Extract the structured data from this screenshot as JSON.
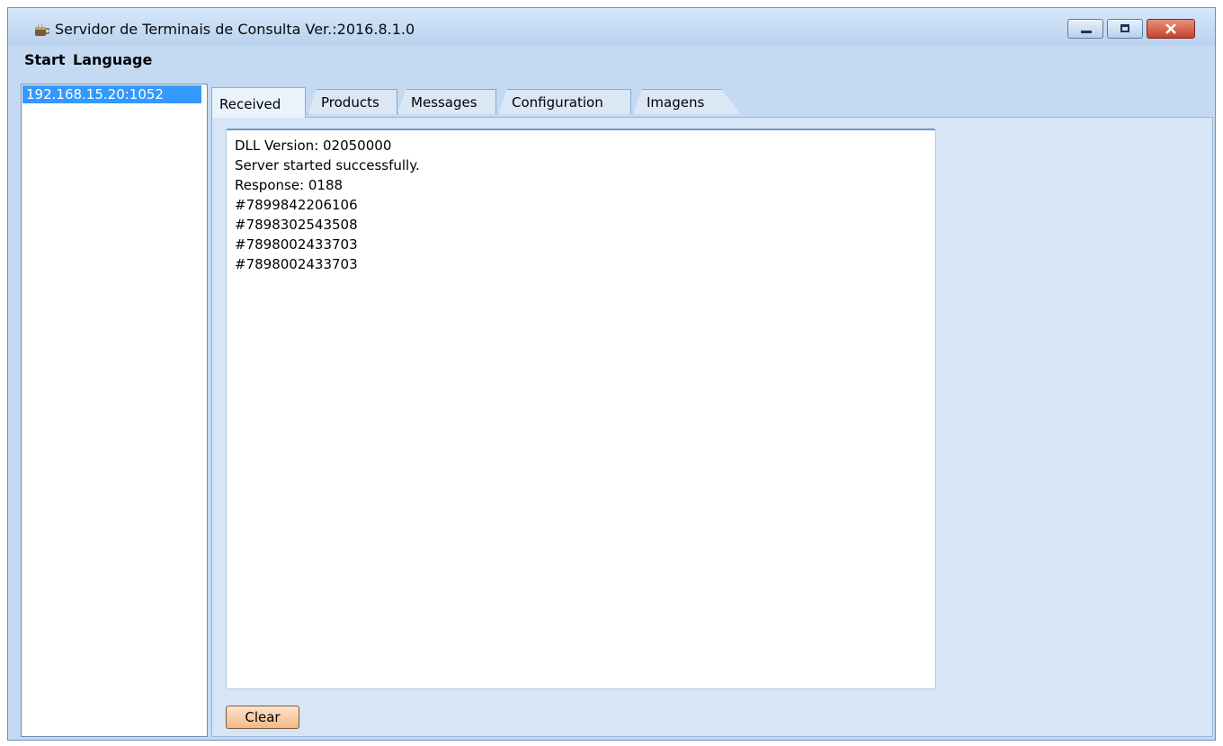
{
  "window": {
    "title": "Servidor de Terminais de Consulta Ver.:2016.8.1.0",
    "app_icon": "coffee-cup-icon",
    "controls": [
      "minimize-icon",
      "maximize-icon",
      "close-icon"
    ]
  },
  "menu": {
    "items": [
      "Start",
      "Language"
    ]
  },
  "connections": {
    "items": [
      "192.168.15.20:1052"
    ],
    "selected_index": 0
  },
  "tabs": {
    "items": [
      "Received",
      "Products",
      "Messages",
      "Configuration",
      "Imagens"
    ],
    "active": "Received"
  },
  "received": {
    "log_lines": [
      "DLL Version: 02050000",
      "Server started successfully.",
      "Response: 0188",
      "#7899842206106",
      "#7898302543508",
      "#7898002433703",
      "#7898002433703"
    ],
    "clear_label": "Clear"
  },
  "colors": {
    "window_bg": "#c4daf3",
    "selection": "#3399ff",
    "close_button": "#c4432c"
  }
}
